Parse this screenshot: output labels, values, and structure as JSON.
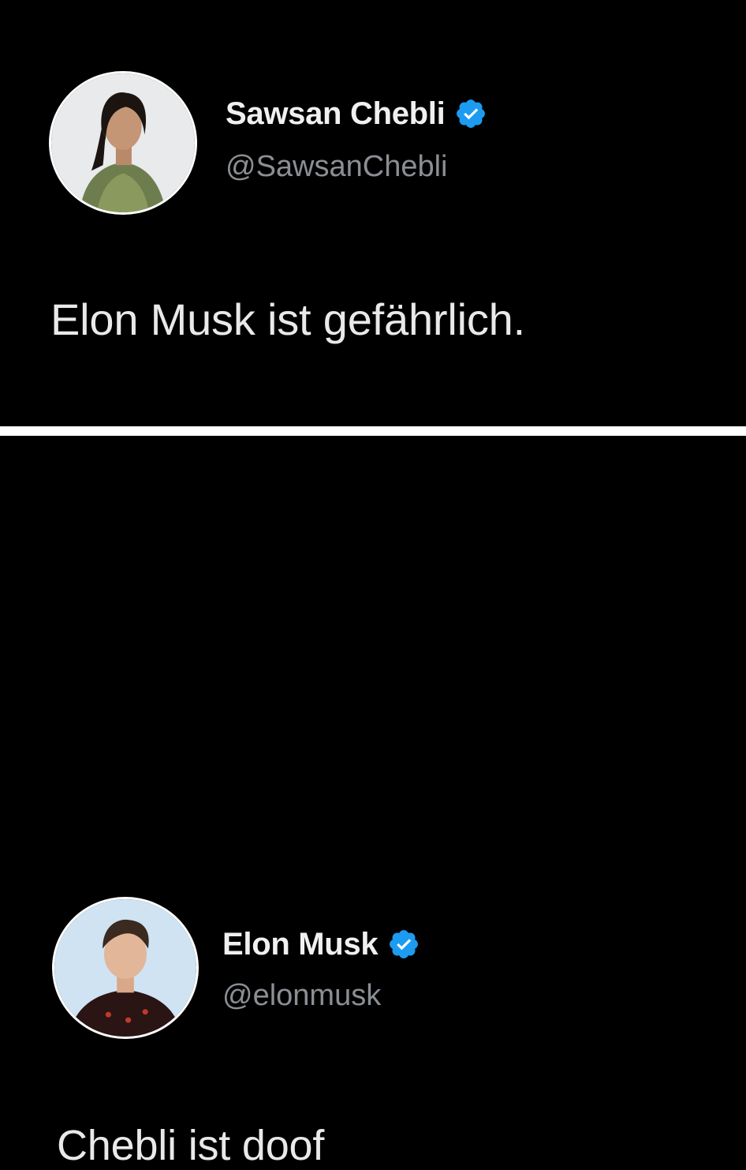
{
  "tweets": [
    {
      "display_name": "Sawsan Chebli",
      "handle": "@SawsanChebli",
      "verified": true,
      "avatar_icon": "avatar-photo",
      "text": "Elon Musk ist gefährlich."
    },
    {
      "display_name": "Elon Musk",
      "handle": "@elonmusk",
      "verified": true,
      "avatar_icon": "avatar-photo",
      "text": "Chebli ist doof"
    }
  ],
  "colors": {
    "background": "#000000",
    "divider": "#ffffff",
    "name": "#f0f0f0",
    "handle": "#8b8f94",
    "text": "#e9e9e9",
    "verified": "#1d9bf0"
  }
}
